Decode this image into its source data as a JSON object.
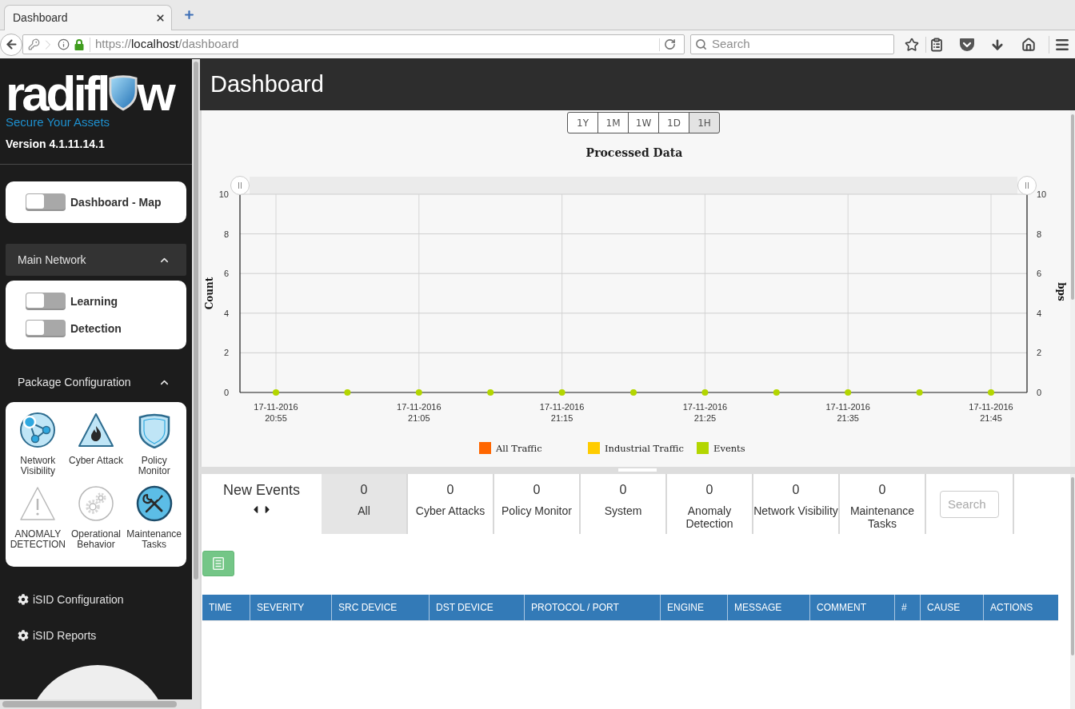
{
  "browser": {
    "tab": {
      "title": "Dashboard"
    },
    "address": {
      "scheme": "https://",
      "host": "localhost",
      "path": "/dashboard"
    },
    "search": {
      "placeholder": "Search"
    }
  },
  "sidebar": {
    "logo": {
      "left": "radifl",
      "right": "w",
      "tagline": "Secure Your Assets"
    },
    "version": "Version 4.1.11.14.1",
    "map_toggle": {
      "label": "Dashboard - Map",
      "on": false
    },
    "main_network": {
      "title": "Main Network",
      "active": true,
      "expanded": true,
      "toggles": [
        {
          "label": "Learning",
          "on": false
        },
        {
          "label": "Detection",
          "on": false
        }
      ]
    },
    "package_configuration": {
      "title": "Package Configuration",
      "active": false,
      "expanded": true,
      "packages": [
        {
          "kind": "network",
          "label": "Network Visibility",
          "enabled": true
        },
        {
          "kind": "attack",
          "label": "Cyber Attack",
          "enabled": true
        },
        {
          "kind": "policy",
          "label": "Policy Monitor",
          "enabled": true
        },
        {
          "kind": "anomaly",
          "label": "ANOMALY DETECTION",
          "enabled": false
        },
        {
          "kind": "operational",
          "label": "Operational Behavior",
          "enabled": false
        },
        {
          "kind": "maintenance",
          "label": "Maintenance Tasks",
          "enabled": true
        }
      ]
    },
    "links": [
      {
        "label": "iSID Configuration"
      },
      {
        "label": "iSID Reports"
      }
    ]
  },
  "header": {
    "title": "Dashboard"
  },
  "chart_panel": {
    "ranges": [
      {
        "label": "1Y",
        "selected": false
      },
      {
        "label": "1M",
        "selected": false
      },
      {
        "label": "1W",
        "selected": false
      },
      {
        "label": "1D",
        "selected": false
      },
      {
        "label": "1H",
        "selected": true
      }
    ],
    "chart_data": {
      "type": "scatter",
      "title": "Processed Data",
      "ylabel": "Count",
      "y2label": "bps",
      "categories": [
        "17-11-2016 20:55",
        null,
        "17-11-2016 21:05",
        null,
        "17-11-2016 21:15",
        null,
        "17-11-2016 21:25",
        null,
        "17-11-2016 21:35",
        null,
        "17-11-2016 21:45"
      ],
      "ylim": [
        0,
        10
      ],
      "yticks": [
        0,
        2,
        4,
        6,
        8,
        10
      ],
      "y2lim": [
        0,
        10
      ],
      "y2ticks": [
        0,
        2,
        4,
        6,
        8,
        10
      ],
      "grid": true,
      "series": [
        {
          "name": "All Traffic",
          "color": "#ff6600",
          "values": [
            null,
            null,
            null,
            null,
            null,
            null,
            null,
            null,
            null,
            null,
            null
          ]
        },
        {
          "name": "Industrial Traffic",
          "color": "#ffcc00",
          "values": [
            null,
            null,
            null,
            null,
            null,
            null,
            null,
            null,
            null,
            null,
            null
          ]
        },
        {
          "name": "Events",
          "color": "#b3d600",
          "values": [
            0,
            0,
            0,
            0,
            0,
            0,
            0,
            0,
            0,
            0,
            0
          ]
        }
      ]
    }
  },
  "events": {
    "title": "New Events",
    "tabs": [
      {
        "count": "0",
        "label": "All",
        "selected": true
      },
      {
        "count": "0",
        "label": "Cyber Attacks",
        "selected": false
      },
      {
        "count": "0",
        "label": "Policy Monitor",
        "selected": false
      },
      {
        "count": "0",
        "label": "System",
        "selected": false
      },
      {
        "count": "0",
        "label": "Anomaly Detection",
        "selected": false
      },
      {
        "count": "0",
        "label": "Network Visibility",
        "selected": false
      },
      {
        "count": "0",
        "label": "Maintenance Tasks",
        "selected": false
      }
    ],
    "search": {
      "placeholder": "Search"
    },
    "table": {
      "columns": [
        "TIME",
        "SEVERITY",
        "SRC DEVICE",
        "DST DEVICE",
        "PROTOCOL / PORT",
        "ENGINE",
        "MESSAGE",
        "COMMENT",
        "#",
        "CAUSE",
        "ACTIONS"
      ]
    }
  }
}
